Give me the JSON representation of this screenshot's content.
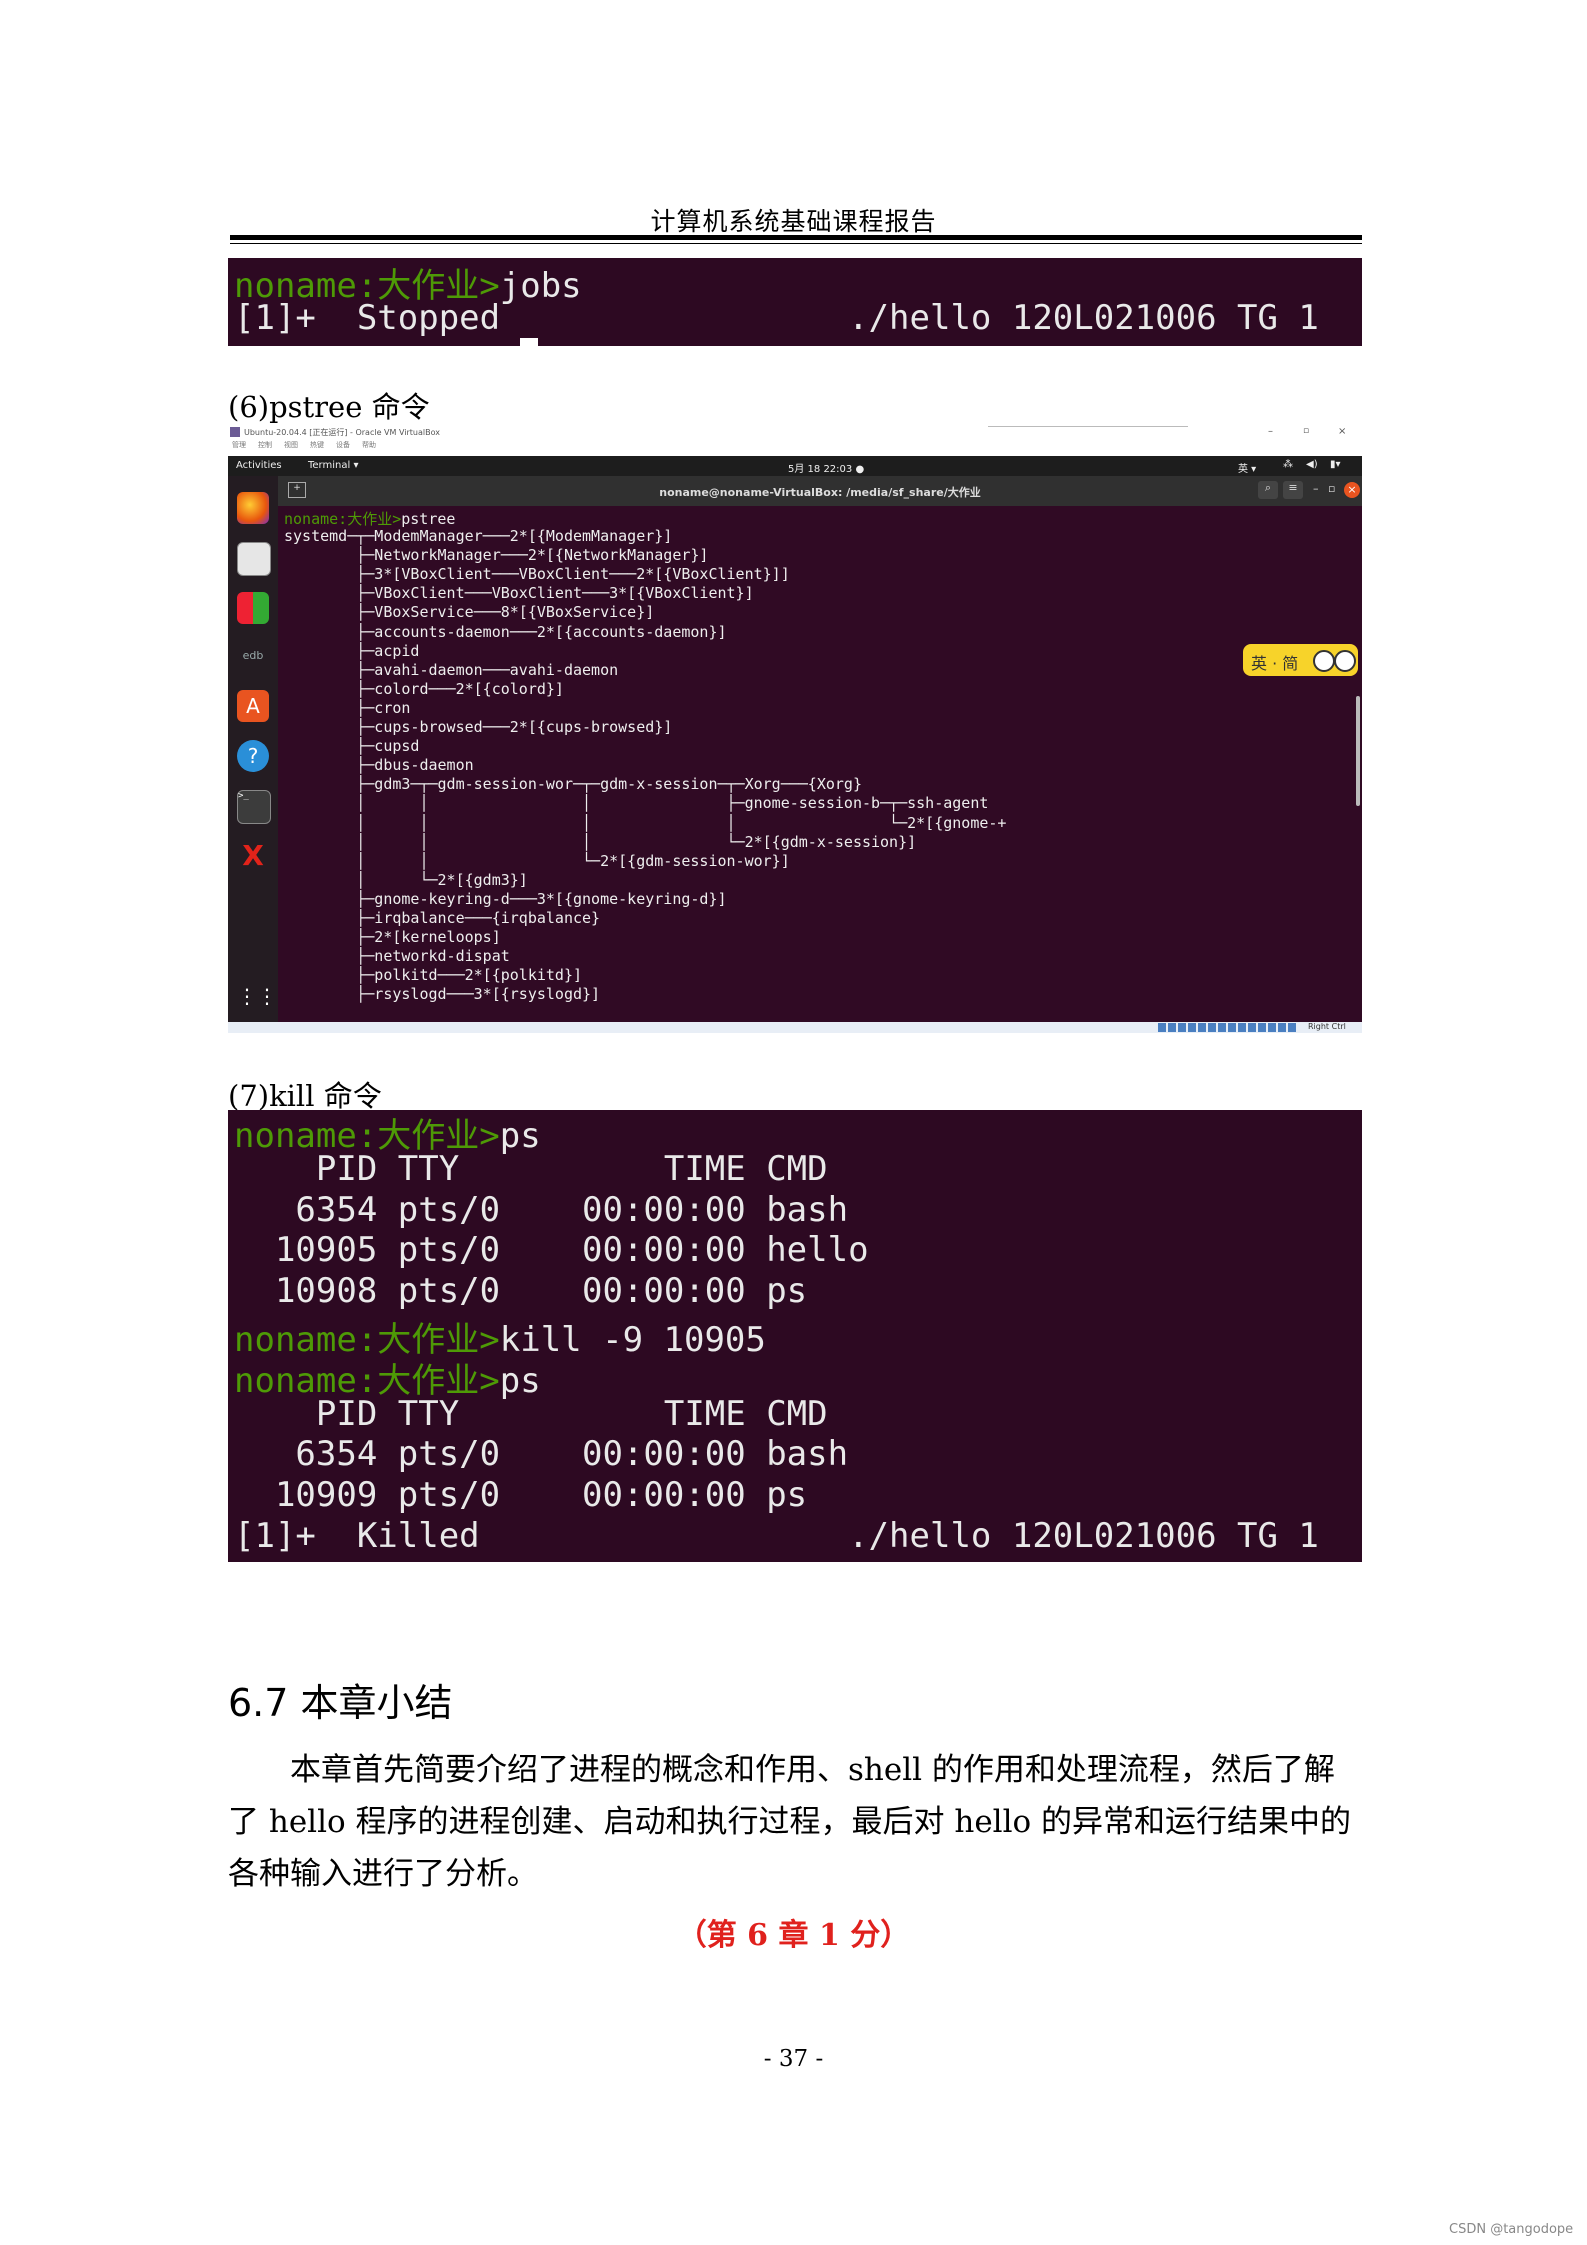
{
  "header": {
    "title": "计算机系统基础课程报告"
  },
  "jobs_terminal": {
    "prompt": "noname:大作业>",
    "command": "jobs",
    "output": "[1]+  Stopped                 ./hello 120L021006 TG 1"
  },
  "pstree_caption": "(6)pstree 命令",
  "vm": {
    "window_title": "Ubuntu-20.04.4 [正在运行] - Oracle VM VirtualBox",
    "menu": [
      "管理",
      "控制",
      "视图",
      "热键",
      "设备",
      "帮助"
    ],
    "activities": "Activities",
    "app_menu": "Terminal ▾",
    "clock": "5月 18  22:03  ●",
    "lang": "英 ▾",
    "terminal_title": "noname@noname-VirtualBox: /media/sf_share/大作业",
    "ime_label": "英 · 简",
    "status_right": "Right Ctrl",
    "dock_label": "edb",
    "prompt": "noname:大作业>",
    "command": "pstree",
    "tree": [
      "systemd─┬─ModemManager───2*[{ModemManager}]",
      "        ├─NetworkManager───2*[{NetworkManager}]",
      "        ├─3*[VBoxClient───VBoxClient───2*[{VBoxClient}]]",
      "        ├─VBoxClient───VBoxClient───3*[{VBoxClient}]",
      "        ├─VBoxService───8*[{VBoxService}]",
      "        ├─accounts-daemon───2*[{accounts-daemon}]",
      "        ├─acpid",
      "        ├─avahi-daemon───avahi-daemon",
      "        ├─colord───2*[{colord}]",
      "        ├─cron",
      "        ├─cups-browsed───2*[{cups-browsed}]",
      "        ├─cupsd",
      "        ├─dbus-daemon",
      "        ├─gdm3─┬─gdm-session-wor─┬─gdm-x-session─┬─Xorg───{Xorg}",
      "        │      │                 │               ├─gnome-session-b─┬─ssh-agent",
      "        │      │                 │               │                 └─2*[{gnome-+",
      "        │      │                 │               └─2*[{gdm-x-session}]",
      "        │      │                 └─2*[{gdm-session-wor}]",
      "        │      └─2*[{gdm3}]",
      "        ├─gnome-keyring-d───3*[{gnome-keyring-d}]",
      "        ├─irqbalance───{irqbalance}",
      "        ├─2*[kerneloops]",
      "        ├─networkd-dispat",
      "        ├─polkitd───2*[{polkitd}]",
      "        ├─rsyslogd───3*[{rsyslogd}]"
    ]
  },
  "kill_caption": "(7)kill 命令",
  "kill_terminal": {
    "lines": [
      {
        "prompt": "noname:大作业>",
        "text": "ps"
      },
      {
        "prompt": "",
        "text": "    PID TTY          TIME CMD"
      },
      {
        "prompt": "",
        "text": "   6354 pts/0    00:00:00 bash"
      },
      {
        "prompt": "",
        "text": "  10905 pts/0    00:00:00 hello"
      },
      {
        "prompt": "",
        "text": "  10908 pts/0    00:00:00 ps"
      },
      {
        "prompt": "noname:大作业>",
        "text": "kill -9 10905"
      },
      {
        "prompt": "noname:大作业>",
        "text": "ps"
      },
      {
        "prompt": "",
        "text": "    PID TTY          TIME CMD"
      },
      {
        "prompt": "",
        "text": "   6354 pts/0    00:00:00 bash"
      },
      {
        "prompt": "",
        "text": "  10909 pts/0    00:00:00 ps"
      },
      {
        "prompt": "",
        "text": "[1]+  Killed                  ./hello 120L021006 TG 1"
      }
    ]
  },
  "section": {
    "title": "6.7 本章小结",
    "paragraph_lines": [
      "本章首先简要介绍了进程的概念和作用、shell 的作用和处理流程，然后了解",
      "了 hello 程序的进程创建、启动和执行过程，最后对 hello 的异常和运行结果中的",
      "各种输入进行了分析。"
    ],
    "score": "（第 6 章 1 分）"
  },
  "page_number": "- 37 -",
  "watermark": "CSDN @tangodope",
  "colors": {
    "terminal_bg": "#2d0922",
    "prompt_green": "#4e9a06",
    "score_red": "#e0211d"
  }
}
